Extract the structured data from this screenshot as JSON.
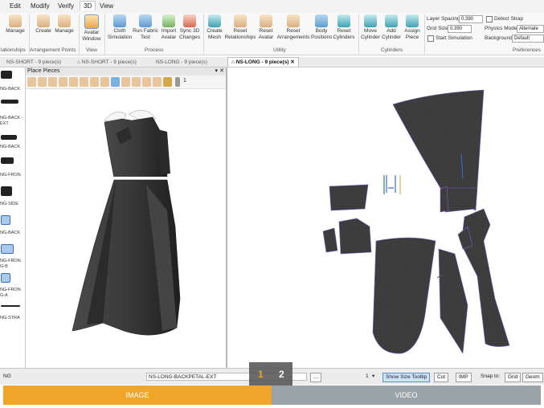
{
  "menu": {
    "items": [
      "Edit",
      "Modify",
      "Verify",
      "3D",
      "View"
    ],
    "active": "3D"
  },
  "ribbon": {
    "buttons": [
      {
        "label": "Manage",
        "icon": "manage-icon"
      },
      {
        "label": "Create",
        "icon": "create-arrangement-icon"
      },
      {
        "label": "Manage",
        "icon": "manage-arrangement-icon"
      },
      {
        "label": "Avatar Window",
        "icon": "avatar-window-icon"
      },
      {
        "label": "Cloth Simulation",
        "icon": "cloth-simulation-icon"
      },
      {
        "label": "Run Fabric Test",
        "icon": "fabric-test-icon"
      },
      {
        "label": "Import Avatar",
        "icon": "import-avatar-icon"
      },
      {
        "label": "Sync 3D Changes",
        "icon": "sync-icon"
      },
      {
        "label": "Create Mesh",
        "icon": "mesh-icon"
      },
      {
        "label": "Reset Relationships",
        "icon": "reset-relationships-icon"
      },
      {
        "label": "Reset Avatar",
        "icon": "reset-avatar-icon"
      },
      {
        "label": "Reset Arrangements",
        "icon": "reset-arrangements-icon"
      },
      {
        "label": "Body Positions",
        "icon": "body-positions-icon"
      },
      {
        "label": "Reset Cylinders",
        "icon": "reset-cylinders-icon"
      },
      {
        "label": "Move Cylinder",
        "icon": "move-cylinder-icon"
      },
      {
        "label": "Add Cylinder",
        "icon": "add-cylinder-icon"
      },
      {
        "label": "Assign Piece",
        "icon": "assign-piece-icon"
      }
    ],
    "groups": [
      "lationships",
      "Arrangement Points",
      "View",
      "Process",
      "Utility",
      "Cylinders",
      "Preferences"
    ],
    "props": {
      "layer_spacing_label": "Layer Spacing",
      "layer_spacing_value": "0.390",
      "grid_size_label": "Grid Size",
      "grid_size_value": "0.390",
      "start_simulation_label": "Start Simulation",
      "detect_strap_label": "Detect Strap",
      "physics_mode_label": "Physics Mode",
      "physics_mode_value": "Alternate",
      "background_label": "Background",
      "background_value": "Default"
    }
  },
  "tabs": [
    {
      "label": "NS-SHORT - 9 piece(s)"
    },
    {
      "label": "NS-SHORT - 9 piece(s)"
    },
    {
      "label": "NS-LONG - 9 piece(s)"
    },
    {
      "label": "NS-LONG - 9 piece(s)",
      "active": true
    }
  ],
  "left_strip": {
    "items": [
      "NG-BACK",
      "NG-BACK -EXT",
      "NG-BACK",
      "NG-FRON",
      "NG-SIDE",
      "NG-BACK",
      "NG-FRON G-B",
      "NG-FRON G-A",
      "NG-STRA"
    ]
  },
  "panel": {
    "title": "Place Pieces",
    "dropdown_value": "1"
  },
  "status": {
    "left_text": "NG",
    "piece_name": "NS-LONG-BACKPETAL-EXT",
    "count_value": "1",
    "show_size_tooltip": "Show Size Tooltip",
    "cut": "Cut",
    "imp": "IMP",
    "snap_to": "Snap to:",
    "grid": "Grid",
    "geom": "Geom"
  },
  "pager": {
    "page1": "1",
    "page2": "2",
    "active": "1"
  },
  "bottom": {
    "image_label": "IMAGE",
    "video_label": "VIDEO"
  },
  "colors": {
    "accent": "#f0a52a",
    "inactive_button": "#9aa3a7",
    "fabric": "#3a3a3a"
  }
}
